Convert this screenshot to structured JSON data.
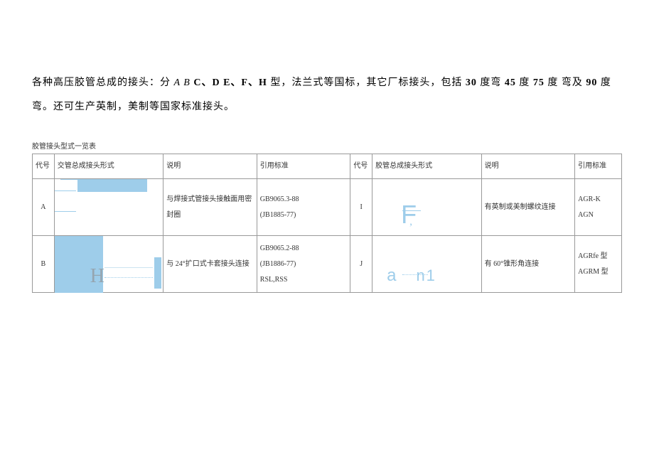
{
  "intro": {
    "part1": "各种高压胶管总成的接头：分 ",
    "abc_italic": "A B",
    "abc_bold": " C、D E、F、H ",
    "part2": "型，法兰式等国标，其它厂标接头，包括 ",
    "deg30": "30",
    "part3": " 度弯 ",
    "deg45": "45",
    "part4": " 度 ",
    "deg75": "75",
    "part5": " 度  弯及 ",
    "deg90": "90",
    "part6": " 度弯。还可生产英制，美制等国家标准接头。"
  },
  "table_title": "胶管接头型式一览表",
  "headers": {
    "code": "代号",
    "form": "交管总成接头形式",
    "desc": "说明",
    "std": "引用标准",
    "code2": "代号",
    "form2": "胶管总成接头形式",
    "desc2": "说明",
    "std2": "引用标准"
  },
  "rows": [
    {
      "code": "A",
      "desc": "与焊接式管接头接触面用密封圈",
      "std": "GB9065.3-88\n(JB1885-77)",
      "code2": "I",
      "desc2": "有英制或美制螺纹连接",
      "std2": "AGR-K\nAGN"
    },
    {
      "code": "B",
      "desc": "与 24°扩口式卡套接头连接",
      "std": "GB9065.2-88\n(JB1886-77)\nRSL,RSS",
      "code2": "J",
      "desc2": "有 60°锥形角连接",
      "std2": "AGRfe 型\nAGRM 型"
    }
  ]
}
